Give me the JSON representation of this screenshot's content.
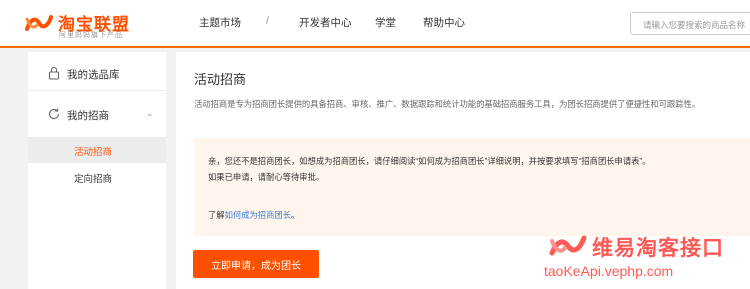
{
  "brand": {
    "title": "淘宝联盟",
    "subtitle": "阿里妈妈旗下产品",
    "accent": "#ff5000"
  },
  "nav": {
    "items": [
      "主题市场",
      "开发者中心",
      "学堂",
      "帮助中心"
    ],
    "separator": "/"
  },
  "search": {
    "placeholder": "请输入您要搜索的商品名称"
  },
  "sidebar": {
    "items": [
      {
        "label": "我的选品库",
        "icon": "lock-icon"
      },
      {
        "label": "我的招商",
        "icon": "sync-icon",
        "chevron": "chevron-down-icon"
      }
    ],
    "subitems": [
      {
        "label": "活动招商",
        "active": true
      },
      {
        "label": "定向招商",
        "active": false
      }
    ]
  },
  "main": {
    "title": "活动招商",
    "description": "活动招商是专为招商团长提供的具备招商、审核、推广、数据跟踪和统计功能的基础招商服务工具，为团长招商提供了便捷性和可跟踪性。",
    "notice": {
      "line1": "亲，您还不是招商团长，如想成为招商团长，请仔细阅读“如何成为招商团长”详细说明，并按要求填写“招商团长申请表”。",
      "line2": "如果已申请，请耐心等待审批。",
      "learn_prefix": "了解",
      "learn_link": "如何成为招商团长",
      "learn_suffix": "。",
      "background": "#fef6ec"
    },
    "apply_button": "立即申请，成为团长"
  },
  "watermark": {
    "title": "维易淘客接口",
    "url": "taoKeApi.vephp.com",
    "color": "#ff5a55"
  }
}
